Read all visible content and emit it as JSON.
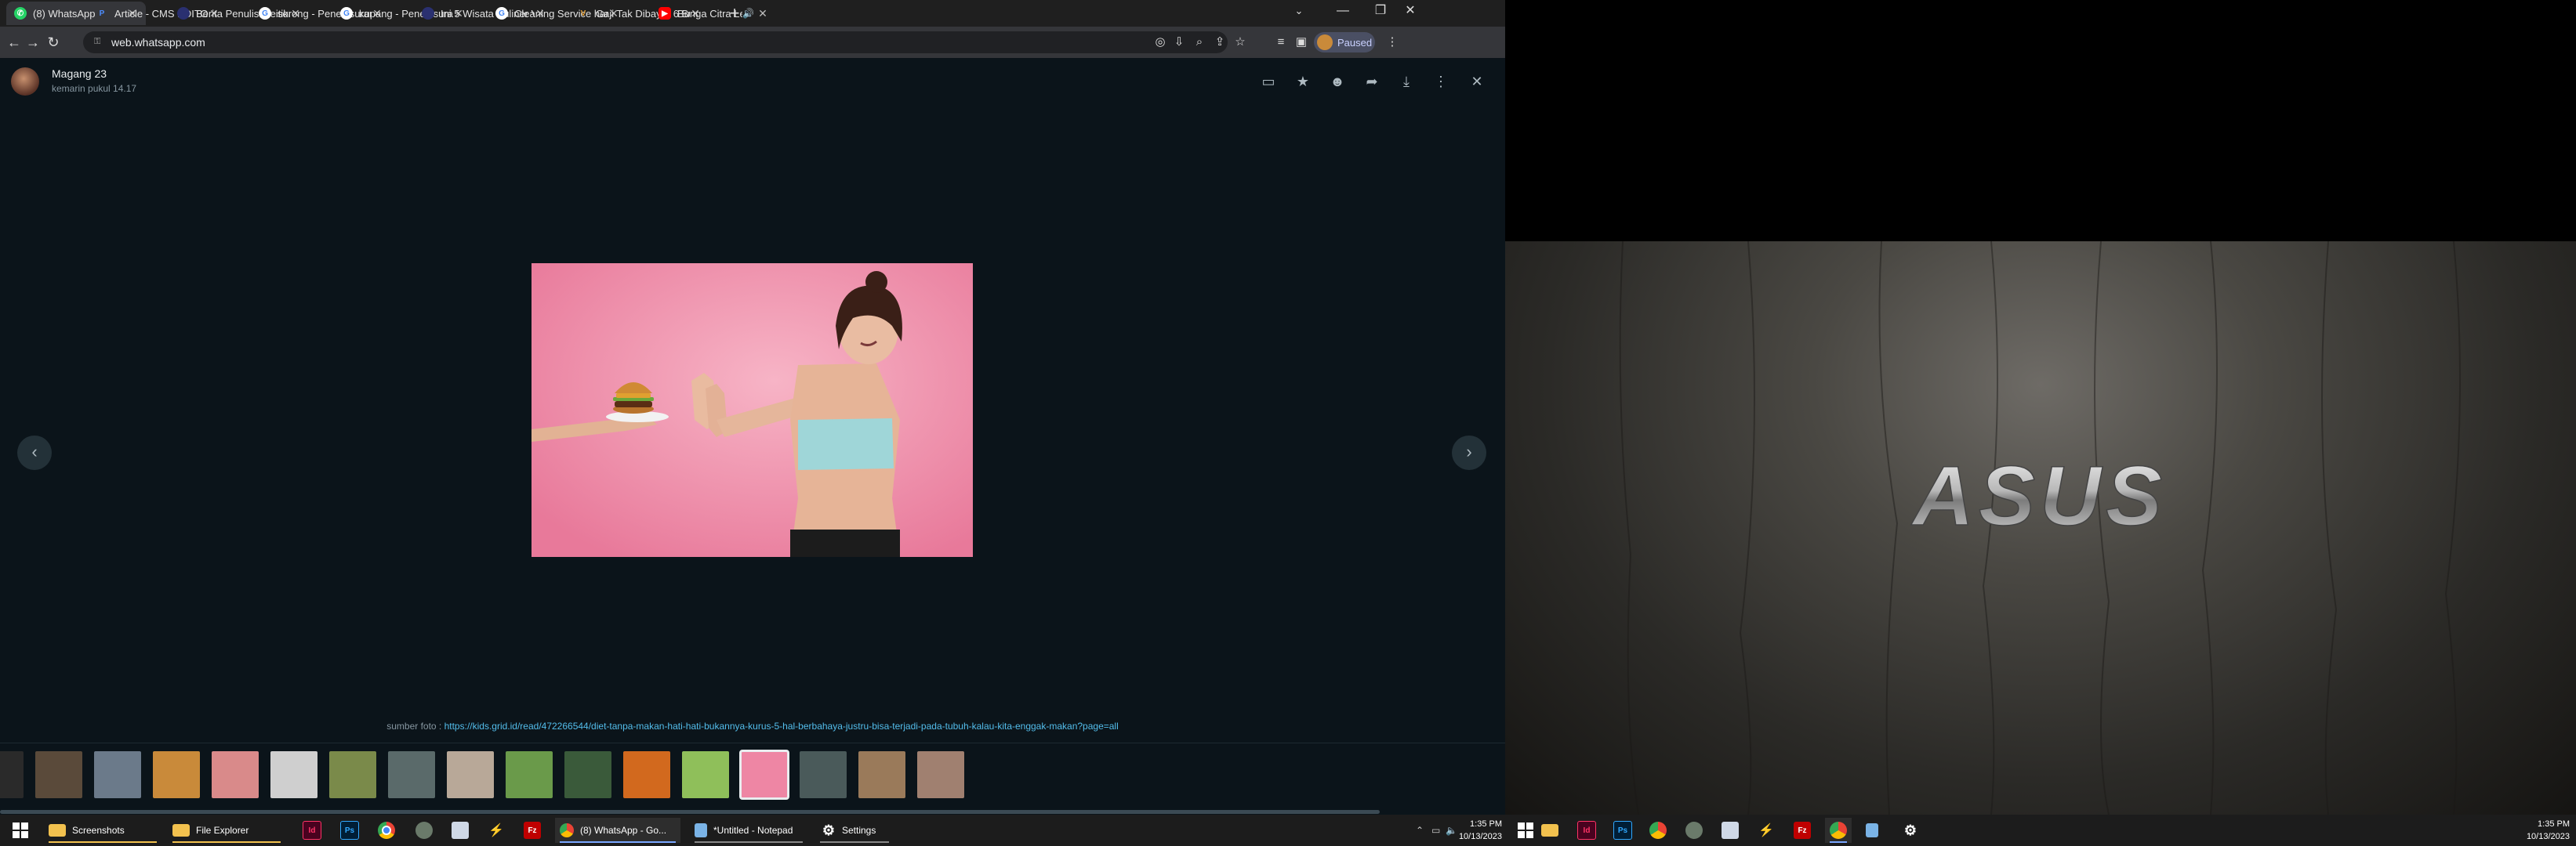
{
  "browser": {
    "tabs": [
      {
        "title": "(8) WhatsApp",
        "icon": "whatsapp-icon",
        "color": "#25d366",
        "active": true
      },
      {
        "title": "Article - CMS EDITOR",
        "icon": "p-logo-icon",
        "color": "#2d6cdf"
      },
      {
        "title": "Berita Penulis Meitika",
        "icon": "site-icon",
        "color": "#333b8f"
      },
      {
        "title": "sorong - Penelusuran",
        "icon": "google-icon",
        "color": "#ffffff"
      },
      {
        "title": "kupang - Penelusuran",
        "icon": "google-icon",
        "color": "#ffffff"
      },
      {
        "title": "Ini 5 Wisata Kuliner V",
        "icon": "site-icon",
        "color": "#333b8f"
      },
      {
        "title": "Cleaning Service ham",
        "icon": "google-icon",
        "color": "#ffffff"
      },
      {
        "title": "Gaji Tak Dibayar 6 Bu",
        "icon": "v-logo-icon",
        "color": "#e6a23c"
      },
      {
        "title": "Bunga Citra Lesta",
        "icon": "youtube-icon",
        "color": "#ff0000",
        "audio": true
      }
    ],
    "url": "web.whatsapp.com",
    "profile_status": "Paused"
  },
  "viewer": {
    "sender": "Magang 23",
    "time": "kemarin pukul 14.17",
    "caption_prefix": "sumber foto : ",
    "caption_link": "https://kids.grid.id/read/472266544/diet-tanpa-makan-hati-hati-bukannya-kurus-5-hal-berbahaya-justru-bisa-terjadi-pada-tubuh-kalau-kita-enggak-makan?page=all",
    "thumbnails": [
      {
        "color": "#2a2a2a"
      },
      {
        "color": "#5a4a3a"
      },
      {
        "color": "#6b7a8a"
      },
      {
        "color": "#c98a3a"
      },
      {
        "color": "#d98a8a"
      },
      {
        "color": "#cfcfcf"
      },
      {
        "color": "#7a8a4a"
      },
      {
        "color": "#5a6a6a"
      },
      {
        "color": "#b8a898"
      },
      {
        "color": "#6a9a4a"
      },
      {
        "color": "#3a5a3a"
      },
      {
        "color": "#d2691e"
      },
      {
        "color": "#8fbf5a"
      },
      {
        "color": "#ee86a4",
        "selected": true
      },
      {
        "color": "#4a5a5a"
      },
      {
        "color": "#9a7a5a"
      },
      {
        "color": "#a08070"
      }
    ]
  },
  "taskbar": {
    "items": [
      {
        "label": "Screenshots",
        "icon": "folder-icon"
      },
      {
        "label": "File Explorer",
        "icon": "file-explorer-icon"
      },
      {
        "label": "(8) WhatsApp - Go...",
        "icon": "chrome-icon",
        "open": true
      },
      {
        "label": "*Untitled - Notepad",
        "icon": "notepad-icon"
      },
      {
        "label": "Settings",
        "icon": "settings-icon"
      }
    ],
    "time": "1:35 PM",
    "date": "10/13/2023"
  },
  "taskbar2": {
    "time": "1:35 PM",
    "date": "10/13/2023"
  },
  "wallpaper": {
    "logo": "ASUS"
  }
}
